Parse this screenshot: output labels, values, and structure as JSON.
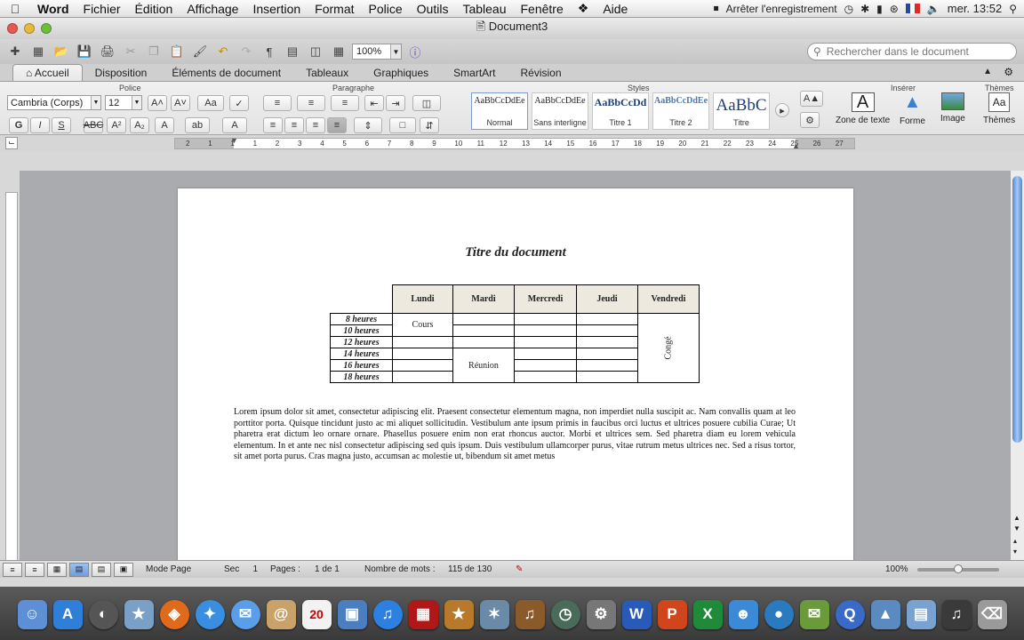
{
  "menubar": {
    "app": "Word",
    "items": [
      "Fichier",
      "Édition",
      "Affichage",
      "Insertion",
      "Format",
      "Police",
      "Outils",
      "Tableau",
      "Fenêtre",
      "Aide"
    ],
    "recording": "Arrêter l'enregistrement",
    "clock": "mer. 13:52"
  },
  "window": {
    "title": "Document3"
  },
  "toolbar": {
    "zoom": "100%",
    "search_placeholder": "Rechercher dans le document"
  },
  "ribbon_tabs": [
    "Accueil",
    "Disposition",
    "Éléments de document",
    "Tableaux",
    "Graphiques",
    "SmartArt",
    "Révision"
  ],
  "ribbon": {
    "groups": {
      "police": "Police",
      "paragraphe": "Paragraphe",
      "styles": "Styles",
      "inserer": "Insérer",
      "themes": "Thèmes"
    },
    "font_name": "Cambria (Corps)",
    "font_size": "12",
    "styles": [
      {
        "preview": "AaBbCcDdEe",
        "name": "Normal"
      },
      {
        "preview": "AaBbCcDdEe",
        "name": "Sans interligne"
      },
      {
        "preview": "AaBbCcDd",
        "name": "Titre 1"
      },
      {
        "preview": "AaBbCcDdEe",
        "name": "Titre 2"
      },
      {
        "preview": "AaBbC",
        "name": "Titre"
      }
    ],
    "insert": {
      "textbox": "Zone de texte",
      "shape": "Forme",
      "image": "Image",
      "themes": "Thèmes"
    }
  },
  "ruler_numbers": [
    "2",
    "1",
    "1",
    "1",
    "2",
    "3",
    "4",
    "5",
    "6",
    "7",
    "8",
    "9",
    "10",
    "11",
    "12",
    "13",
    "14",
    "15",
    "16",
    "17",
    "18",
    "19",
    "20",
    "21",
    "22",
    "23",
    "24",
    "25",
    "26",
    "27"
  ],
  "document": {
    "title": "Titre du document",
    "table": {
      "days": [
        "Lundi",
        "Mardi",
        "Mercredi",
        "Jeudi",
        "Vendredi"
      ],
      "hours": [
        "8 heures",
        "10 heures",
        "12 heures",
        "14 heures",
        "16 heures",
        "18 heures"
      ],
      "cours": "Cours",
      "reunion": "Réunion",
      "conge": "Congé"
    },
    "paragraph": "Lorem ipsum dolor sit amet, consectetur adipiscing elit. Praesent consectetur elementum magna, non imperdiet nulla suscipit ac. Nam convallis quam at leo porttitor porta. Quisque tincidunt justo ac mi aliquet sollicitudin. Vestibulum ante ipsum primis in faucibus orci luctus et ultrices posuere cubilia Curae; Ut pharetra erat dictum leo ornare ornare. Phasellus posuere enim non erat rhoncus auctor. Morbi et ultrices sem. Sed pharetra diam eu lorem vehicula elementum. In et ante nec nisl consectetur adipiscing sed quis ipsum. Duis vestibulum ullamcorper purus, vitae rutrum metus ultrices nec. Sed a risus tortor, sit amet porta purus. Cras magna justo, accumsan ac molestie ut, bibendum sit amet metus"
  },
  "status": {
    "mode": "Mode Page",
    "sec_label": "Sec",
    "sec_value": "1",
    "pages_label": "Pages :",
    "pages_value": "1 de 1",
    "words_label": "Nombre de mots :",
    "words_value": "115 de 130",
    "zoom": "100%",
    "zoom_slider_fraction": 0.5
  }
}
